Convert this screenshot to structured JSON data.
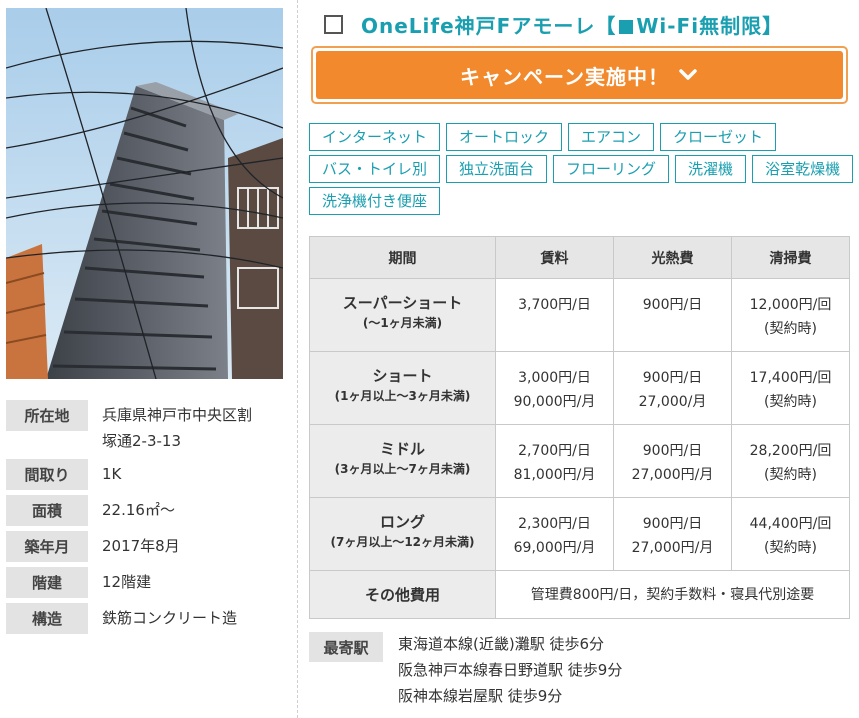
{
  "property": {
    "title_prefix": "OneLife神戸Fアモーレ【",
    "title_suffix": "Wi-Fi無制限】",
    "campaign_label": "キャンペーン実施中！"
  },
  "photo": {
    "icon": "building-photo"
  },
  "spec": [
    {
      "label": "所在地",
      "value": "兵庫県神戸市中央区割\n塚通2-3-13"
    },
    {
      "label": "間取り",
      "value": "1K"
    },
    {
      "label": "面積",
      "value": "22.16㎡～"
    },
    {
      "label": "築年月",
      "value": "2017年8月"
    },
    {
      "label": "階建",
      "value": "12階建"
    },
    {
      "label": "構造",
      "value": "鉄筋コンクリート造"
    }
  ],
  "tags": [
    "インターネット",
    "オートロック",
    "エアコン",
    "クローゼット",
    "バス・トイレ別",
    "独立洗面台",
    "フローリング",
    "洗濯機",
    "浴室乾燥機",
    "洗浄機付き便座"
  ],
  "price_table": {
    "headers": [
      "期間",
      "賃料",
      "光熱費",
      "清掃費"
    ],
    "rows": [
      {
        "name": "スーパーショート",
        "sub": "(～1ヶ月未満)",
        "rent": "3,700円/日",
        "utility": "900円/日",
        "cleaning": "12,000円/回\n(契約時)"
      },
      {
        "name": "ショート",
        "sub": "(1ヶ月以上～3ヶ月未満)",
        "rent": "3,000円/日\n90,000円/月",
        "utility": "900円/日\n27,000/月",
        "cleaning": "17,400円/回\n(契約時)"
      },
      {
        "name": "ミドル",
        "sub": "(3ヶ月以上～7ヶ月未満)",
        "rent": "2,700円/日\n81,000円/月",
        "utility": "900円/日\n27,000円/月",
        "cleaning": "28,200円/回\n(契約時)"
      },
      {
        "name": "ロング",
        "sub": "(7ヶ月以上～12ヶ月未満)",
        "rent": "2,300円/日\n69,000円/月",
        "utility": "900円/日\n27,000円/月",
        "cleaning": "44,400円/回\n(契約時)"
      }
    ],
    "other_label": "その他費用",
    "other_value": "管理費800円/日，契約手数料・寝具代別途要"
  },
  "station": {
    "label": "最寄駅",
    "lines": [
      "東海道本線(近畿)灘駅 徒歩6分",
      "阪急神戸本線春日野道駅 徒歩9分",
      "阪神本線岩屋駅 徒歩9分"
    ]
  },
  "colors": {
    "accent": "#1a9fb0",
    "campaign": "#f28a2d",
    "label_bg": "#e3e3e3"
  }
}
